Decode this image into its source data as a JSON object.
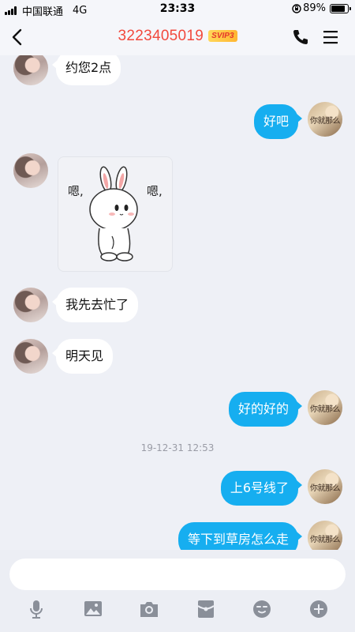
{
  "status_bar": {
    "carrier": "中国联通",
    "network": "4G",
    "time": "23:33",
    "battery": "89%",
    "battery_level": 0.89
  },
  "header": {
    "title": "3223405019",
    "vip_badge": "SVIP3"
  },
  "messages": [
    {
      "side": "in",
      "type": "text",
      "text": "约您2点"
    },
    {
      "side": "out",
      "type": "text",
      "text": "好吧",
      "avatar_text": "你就那么 卞…"
    },
    {
      "side": "in",
      "type": "sticker",
      "sticker_text_left": "嗯,",
      "sticker_text_right": "嗯,"
    },
    {
      "side": "in",
      "type": "text",
      "text": "我先去忙了"
    },
    {
      "side": "in",
      "type": "text",
      "text": "明天见"
    },
    {
      "side": "out",
      "type": "text",
      "text": "好的好的",
      "avatar_text": "你就那么 卞…"
    },
    {
      "side": "system",
      "type": "time",
      "text": "19-12-31 12:53"
    },
    {
      "side": "out",
      "type": "text",
      "text": "上6号线了",
      "avatar_text": "你就那么 卞…"
    },
    {
      "side": "out",
      "type": "text",
      "text": "等下到草房怎么走",
      "avatar_text": "你就那么 卞…"
    }
  ],
  "me_avatar_text": "你就那么",
  "input": {
    "value": "",
    "placeholder": ""
  },
  "toolbar": {
    "icons": [
      "microphone-icon",
      "image-icon",
      "camera-icon",
      "red-packet-icon",
      "emoji-icon",
      "plus-icon"
    ]
  },
  "colors": {
    "title": "#f2493d",
    "outgoing_bubble": "#16aef0",
    "incoming_bubble": "#ffffff",
    "background": "#eef0f6"
  }
}
